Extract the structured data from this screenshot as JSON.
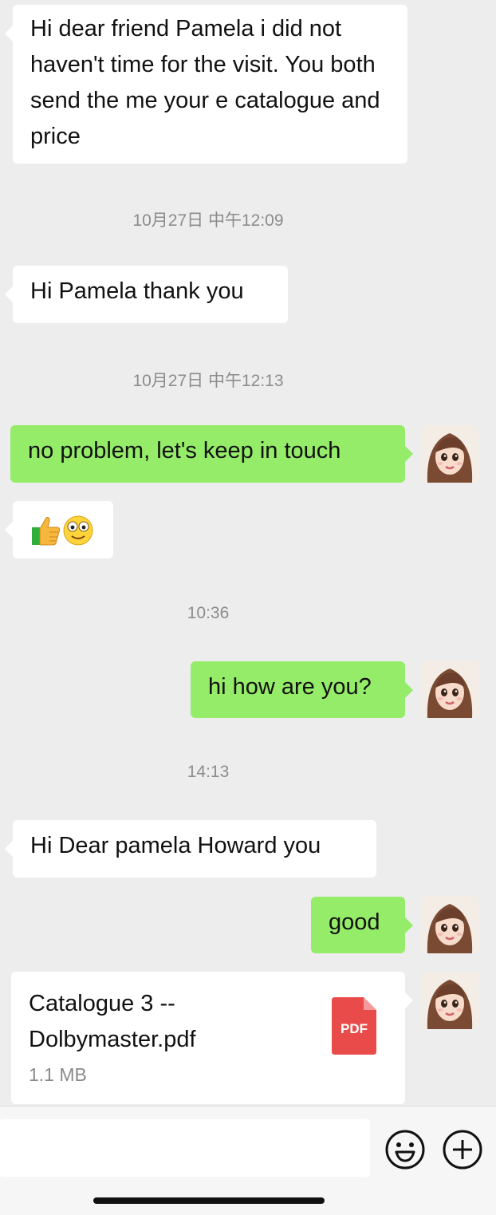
{
  "messages": [
    {
      "kind": "in",
      "text": "Hi dear friend Pamela i did not haven't time for the visit. You both send the me your e catalogue and price"
    },
    {
      "kind": "in",
      "text": "Hi Pamela thank you"
    },
    {
      "kind": "out",
      "text": "no problem, let's keep in touch"
    },
    {
      "kind": "in",
      "text": "👍🙂",
      "emoji": [
        "thumbs-up-icon",
        "smiling-face-icon"
      ]
    },
    {
      "kind": "out",
      "text": "hi how are you?"
    },
    {
      "kind": "in",
      "text": "Hi Dear pamela Howard you"
    },
    {
      "kind": "out",
      "text": "good"
    }
  ],
  "timestamps": [
    "10月27日 中午12:09",
    "10月27日 中午12:13",
    "10:36",
    "14:13"
  ],
  "file": {
    "name": "Catalogue 3 -- Dolbymaster.pdf",
    "size": "1.1 MB",
    "type_label": "PDF",
    "icon": "pdf-file-icon"
  },
  "input": {
    "value": "",
    "placeholder": ""
  },
  "icons": {
    "emoji_button": "smiley-face-icon",
    "more_button": "plus-circle-icon"
  },
  "colors": {
    "background": "#ededed",
    "incoming_bubble": "#ffffff",
    "outgoing_bubble": "#95ec69",
    "timestamp_text": "#8c8c8c",
    "pdf_red": "#e94b4b"
  }
}
